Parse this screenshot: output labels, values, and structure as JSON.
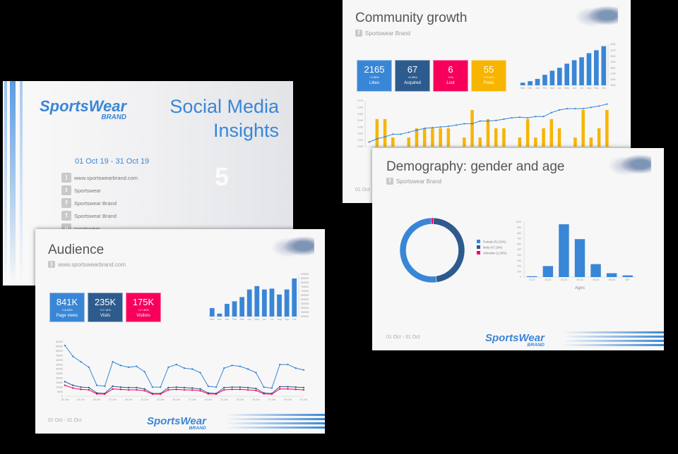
{
  "cover": {
    "logo": "SportsWear",
    "logo_sub": "BRAND",
    "title_line1": "Social Media",
    "title_line2": "Insights",
    "date_range": "01 Oct 19  -  31 Oct 19",
    "links": [
      {
        "icon": "rss-icon",
        "label": "www.sportswearbrand.com"
      },
      {
        "icon": "twitter-icon",
        "label": "Sportswear"
      },
      {
        "icon": "facebook-icon",
        "label": "Sportswear Brand"
      },
      {
        "icon": "facebook-icon",
        "label": "Sportswear Brand"
      },
      {
        "icon": "instagram-icon",
        "label": "sportswear"
      }
    ]
  },
  "community": {
    "title": "Community growth",
    "source": "Sportswear Brand",
    "date": "01 Oct",
    "tiles": [
      {
        "value": "2165",
        "delta": "+2.65%",
        "label": "Likes",
        "color": "#3a86d6"
      },
      {
        "value": "67",
        "delta": "+6.35%",
        "label": "Acquired",
        "color": "#2d5b8e"
      },
      {
        "value": "6",
        "delta": "+0%",
        "label": "Lost",
        "color": "#f7005c"
      },
      {
        "value": "55",
        "delta": "+22.22%",
        "label": "Posts",
        "color": "#f7b500"
      }
    ]
  },
  "demography": {
    "title": "Demography: gender and age",
    "source": "Sportswear Brand",
    "date": "01 Oct  -  31 Oct",
    "logo": "SportsWear",
    "logo_sub": "BRAND"
  },
  "audience": {
    "title": "Audience",
    "source": "www.sportswearbrand.com",
    "date": "01 Oct  -  31 Oct",
    "logo": "SportsWear",
    "logo_sub": "BRAND",
    "tiles": [
      {
        "value": "841K",
        "delta": "+18.08%",
        "label": "Page views",
        "color": "#3a86d6"
      },
      {
        "value": "235K",
        "delta": "+17.14%",
        "label": "Visits",
        "color": "#2d5b8e"
      },
      {
        "value": "175K",
        "delta": "+17.45%",
        "label": "Visitors",
        "color": "#f7005c"
      }
    ]
  },
  "chart_data": [
    {
      "id": "likes-monthly",
      "type": "bar",
      "categories": [
        "Nov",
        "Dec",
        "Jan",
        "Feb",
        "Mar",
        "Apr",
        "May",
        "Jun",
        "Jul",
        "Aug",
        "Sep",
        "Oct"
      ],
      "values": [
        1545,
        1570,
        1610,
        1680,
        1750,
        1800,
        1870,
        1930,
        1980,
        2050,
        2100,
        2170
      ],
      "ylim": [
        1500,
        2200
      ],
      "yticks": [
        1500,
        1600,
        1700,
        1800,
        1900,
        2000,
        2100,
        2200
      ],
      "color": "#3a86d6"
    },
    {
      "id": "likes-daily",
      "type": "bar+line",
      "ylim": [
        2100,
        2170
      ],
      "yticks": [
        2100,
        2110,
        2120,
        2130,
        2140,
        2150,
        2160,
        2170
      ],
      "bars": [
        0,
        2142,
        2142,
        2114,
        0,
        2114,
        2128,
        2128,
        2128,
        2128,
        2128,
        0,
        2114,
        2156,
        2114,
        2142,
        2128,
        2128,
        0,
        2114,
        2142,
        2114,
        2128,
        2142,
        2128,
        0,
        2114,
        2156,
        2114,
        2128,
        2156
      ],
      "line": [
        2107,
        2112,
        2115,
        2119,
        2119,
        2122,
        2125,
        2128,
        2129,
        2130,
        2131,
        2133,
        2135,
        2135,
        2139,
        2139,
        2140,
        2142,
        2144,
        2145,
        2144,
        2146,
        2146,
        2152,
        2156,
        2158,
        2158,
        2158,
        2160,
        2162,
        2165
      ],
      "bar_color": "#f7b500",
      "line_color": "#3a86d6"
    },
    {
      "id": "gender",
      "type": "pie",
      "donut": true,
      "slices": [
        {
          "label": "Female (51.52%)",
          "value": 51.52,
          "color": "#3a86d6"
        },
        {
          "label": "Male (47.19%)",
          "value": 47.19,
          "color": "#2d5b8e"
        },
        {
          "label": "Unknown (1.29%)",
          "value": 1.29,
          "color": "#f7005c"
        }
      ],
      "legend": "right"
    },
    {
      "id": "ages",
      "type": "bar",
      "categories": [
        "13-17",
        "18-24",
        "25-34",
        "35-44",
        "45-54",
        "55-64",
        "65+"
      ],
      "values": [
        15,
        200,
        960,
        690,
        235,
        70,
        30
      ],
      "ylim": [
        0,
        1000
      ],
      "yticks": [
        0,
        100,
        200,
        300,
        400,
        500,
        600,
        700,
        800,
        900,
        1000
      ],
      "xlabel": "Ages",
      "color": "#3a86d6"
    },
    {
      "id": "pageviews-monthly",
      "type": "bar",
      "categories": [
        "Nov",
        "Dec",
        "Jan",
        "Feb",
        "Mar",
        "Apr",
        "May",
        "Jun",
        "Jul",
        "Aug",
        "Sep",
        "Oct"
      ],
      "values": [
        500000,
        435000,
        550000,
        580000,
        630000,
        720000,
        760000,
        720000,
        730000,
        660000,
        720000,
        850000
      ],
      "ylim": [
        400000,
        900000
      ],
      "yticks": [
        400000,
        450000,
        500000,
        550000,
        600000,
        650000,
        700000,
        750000,
        800000,
        850000,
        900000
      ],
      "color": "#3a86d6"
    },
    {
      "id": "audience-daily",
      "type": "line",
      "ylim": [
        0,
        60000
      ],
      "yticks": [
        0,
        5000,
        10000,
        15000,
        20000,
        25000,
        30000,
        35000,
        40000,
        45000,
        50000,
        55000,
        60000
      ],
      "xticks": [
        "01 Oct",
        "03 Oct",
        "05 Oct",
        "07 Oct",
        "09 Oct",
        "11 Oct",
        "13 Oct",
        "15 Oct",
        "17 Oct",
        "19 Oct",
        "21 Oct",
        "23 Oct",
        "25 Oct",
        "27 Oct",
        "29 Oct",
        "31 Oct"
      ],
      "series": [
        {
          "color": "#3a86d6",
          "values": [
            56000,
            44000,
            38000,
            32000,
            12000,
            11000,
            38000,
            34000,
            32000,
            33000,
            27000,
            10000,
            10000,
            32000,
            35000,
            31000,
            30000,
            26000,
            11000,
            10000,
            31000,
            34000,
            33000,
            30000,
            26000,
            10000,
            9000,
            35000,
            35000,
            31000,
            29000
          ]
        },
        {
          "color": "#2d5b8e",
          "values": [
            16000,
            12000,
            10000,
            9500,
            3500,
            3000,
            11000,
            10000,
            9500,
            9500,
            8000,
            3000,
            3000,
            9500,
            10000,
            9500,
            9000,
            8000,
            3500,
            3000,
            9500,
            10000,
            10000,
            9500,
            8500,
            3500,
            3000,
            10500,
            10500,
            10000,
            9500
          ]
        },
        {
          "color": "#f7005c",
          "values": [
            12000,
            9000,
            7500,
            7000,
            2500,
            2300,
            8000,
            7500,
            7000,
            7000,
            6000,
            2300,
            2300,
            7000,
            7500,
            7000,
            6800,
            6000,
            2600,
            2300,
            7000,
            7500,
            7500,
            7000,
            6300,
            2600,
            2300,
            8000,
            8000,
            7500,
            7000
          ]
        }
      ]
    }
  ]
}
